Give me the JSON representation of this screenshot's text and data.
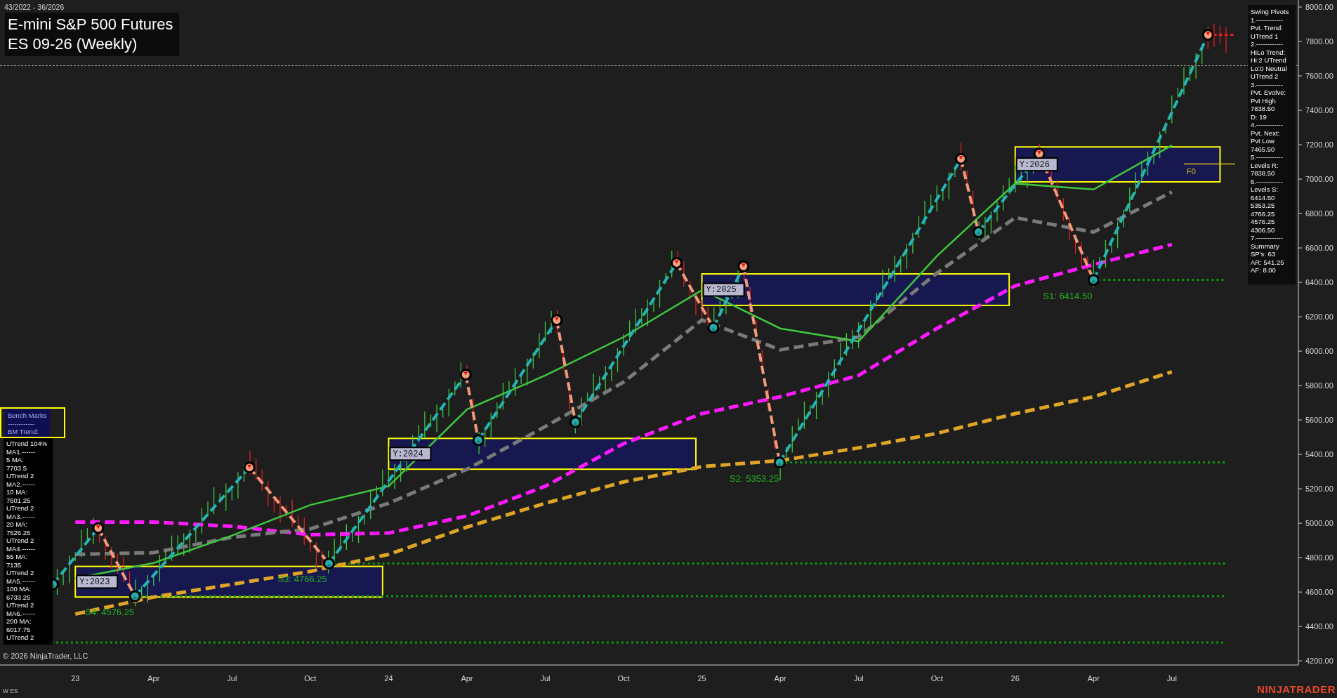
{
  "header": {
    "date_range": "43/2022 - 36/2026",
    "title_lines": [
      "E-mini S&P 500 Futures",
      "ES 09-26 (Weekly)"
    ]
  },
  "chart": {
    "chart_data": {
      "type": "line",
      "ylim": [
        4176,
        8041
      ],
      "categories": [
        null,
        "23",
        "Apr",
        "Jul",
        "Oct",
        "24",
        "Apr",
        "Jul",
        "Oct",
        "25",
        "Apr",
        "Jul",
        "Oct",
        "26",
        "Apr",
        "Jul",
        null
      ],
      "yticks": [
        {
          "value": 4200,
          "label": "4200.00"
        },
        {
          "value": 4400,
          "label": "4400.00"
        },
        {
          "value": 4600,
          "label": "4600.00"
        },
        {
          "value": 4800,
          "label": "4800.00"
        },
        {
          "value": 5000,
          "label": "5000.00"
        },
        {
          "value": 5200,
          "label": "5200.00"
        },
        {
          "value": 5400,
          "label": "5400.00"
        },
        {
          "value": 5600,
          "label": "5600.00"
        },
        {
          "value": 5800,
          "label": "5800.00"
        },
        {
          "value": 6000,
          "label": "6000.00"
        },
        {
          "value": 6200,
          "label": "6200.00"
        },
        {
          "value": 6400,
          "label": "6400.00"
        },
        {
          "value": 6600,
          "label": "6600.00"
        },
        {
          "value": 6800,
          "label": "6800.00"
        },
        {
          "value": 7000,
          "label": "7000.00"
        },
        {
          "value": 7200,
          "label": "7200.00"
        },
        {
          "value": 7400,
          "label": "7400.00"
        },
        {
          "value": 7600,
          "label": "7600.00"
        },
        {
          "value": 7800,
          "label": "7800.00"
        },
        {
          "value": 8000,
          "label": "8000.00"
        }
      ],
      "series": [
        {
          "color": "#e0a526",
          "line_style": "dashed",
          "values": [
            null,
            4472,
            4571,
            4645,
            4720,
            4819,
            4978,
            5116,
            5240,
            5329,
            5364,
            5438,
            5522,
            5637,
            5735,
            5880,
            null
          ]
        },
        {
          "color": "#ff1aff",
          "line_style": "dashed",
          "values": [
            null,
            5007,
            5007,
            4982,
            4933,
            4943,
            5042,
            5215,
            5463,
            5637,
            5735,
            5859,
            6132,
            6380,
            6503,
            6620,
            null
          ]
        },
        {
          "color": "#7a7a7a",
          "line_style": "dashed",
          "values": [
            null,
            4819,
            4829,
            4918,
            4967,
            5116,
            5314,
            5562,
            5820,
            6181,
            6008,
            6082,
            6454,
            6776,
            6692,
            6925,
            null
          ]
        },
        {
          "color": "#3ec83e",
          "line_style": "solid",
          "values": [
            null,
            4680,
            4769,
            4928,
            5106,
            5215,
            5661,
            5859,
            6082,
            6355,
            6132,
            6057,
            6553,
            6974,
            6940,
            7197,
            null
          ]
        }
      ],
      "ref_lines": [
        {
          "axis": "y",
          "value": 6414.5,
          "label": "S1: 6414.50",
          "color": "#0b9a0b",
          "line_style": "dotted"
        },
        {
          "axis": "y",
          "value": 5353.25,
          "label": "S2: 5353.25",
          "color": "#0b9a0b",
          "line_style": "dotted"
        },
        {
          "axis": "y",
          "value": 4766.25,
          "label": "S3: 4766.25",
          "color": "#0b9a0b",
          "line_style": "dotted"
        },
        {
          "axis": "y",
          "value": 4576.25,
          "label": "S4: 4576.25",
          "color": "#0b9a0b",
          "line_style": "dotted"
        },
        {
          "axis": "y",
          "value": 4306.5,
          "color": "#0b9a0b",
          "line_style": "dotted"
        },
        {
          "axis": "y",
          "value": 7088,
          "label": "F0",
          "color": "#d4c020",
          "line_style": "solid"
        }
      ]
    },
    "zone_labels": [
      "Y:2023",
      "Y:2024",
      "Y:2025",
      "Y:2026"
    ]
  },
  "swing_pivots_panel": {
    "lines": [
      "Swing Pivots",
      "1.------------",
      "Pvt. Trend:",
      "UTrend 1",
      "2.------------",
      "HiLo Trend:",
      "Hi:2 UTrend",
      "Lo:0 Neutral",
      "UTrend 2",
      "3.------------",
      "Pvt. Evolve:",
      "Pvt High",
      "7838.50",
      "D: 19",
      "4.------------",
      "Pvt. Next:",
      "Pvt Low",
      "7465.50",
      "5.------------",
      "Levels R:",
      "7838.50",
      "6.------------",
      "Levels S:",
      "6414.50",
      "5353.25",
      "4766.25",
      "4576.25",
      "4306.50",
      "7.------------",
      "Summary",
      "SP's: 63",
      "AR: 541.25",
      "AF: 8.00"
    ]
  },
  "bench_marks_panel": {
    "header_lines": [
      "Bench Marks",
      "------------",
      "BM Trend:"
    ],
    "lines": [
      "UTrend 104%",
      "MA1.------",
      "5 MA:",
      "7703.5",
      "UTrend 2",
      "MA2.------",
      "10 MA:",
      "7601.25",
      "UTrend 2",
      "MA3.------",
      "20 MA:",
      "7526.25",
      "UTrend 2",
      "MA4.------",
      "55 MA:",
      "7135",
      "UTrend 2",
      "MA5.------",
      "100 MA:",
      "6733.25",
      "UTrend 2",
      "MA6.------",
      "200 MA:",
      "6017.75",
      "UTrend 2"
    ]
  },
  "footer": {
    "copyright": "© 2026 NinjaTrader, LLC",
    "instrument": "W ES",
    "brand": "NINJATRADER"
  }
}
